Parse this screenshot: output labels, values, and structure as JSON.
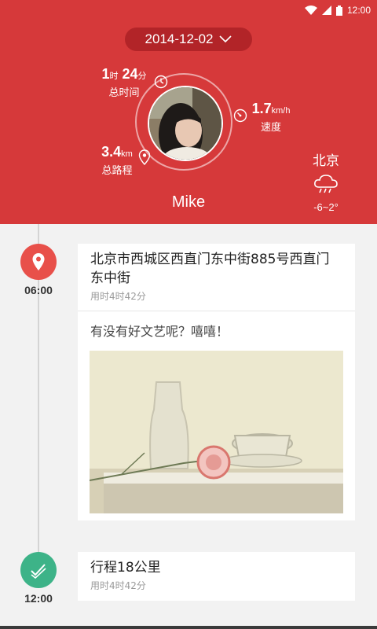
{
  "status_bar": {
    "time": "12:00"
  },
  "header": {
    "date": "2014-12-02",
    "duration": {
      "hours": "1",
      "hours_unit": "时",
      "minutes": "24",
      "minutes_unit": "分",
      "label": "总时间"
    },
    "speed": {
      "value": "1.7",
      "unit": "km/h",
      "label": "速度"
    },
    "distance": {
      "value": "3.4",
      "unit": "km",
      "label": "总路程"
    },
    "username": "Mike",
    "weather": {
      "city": "北京",
      "temp": "-6~2°"
    }
  },
  "colors": {
    "header_red": "#d6393a",
    "pill_red": "#b22428",
    "location_marker": "#e8504a",
    "trip_marker": "#3db388"
  },
  "timeline": [
    {
      "time": "06:00",
      "icon": "location-pin-icon",
      "address": "北京市西城区西直门东中街885号西直门东中街",
      "duration": "用时4时42分",
      "note": "有没有好文艺呢？嘻嘻！",
      "photo": "still-life-carnation-glass-cup"
    },
    {
      "time": "12:00",
      "icon": "trip-check-icon",
      "title": "行程18公里",
      "duration": "用时4时42分"
    }
  ]
}
